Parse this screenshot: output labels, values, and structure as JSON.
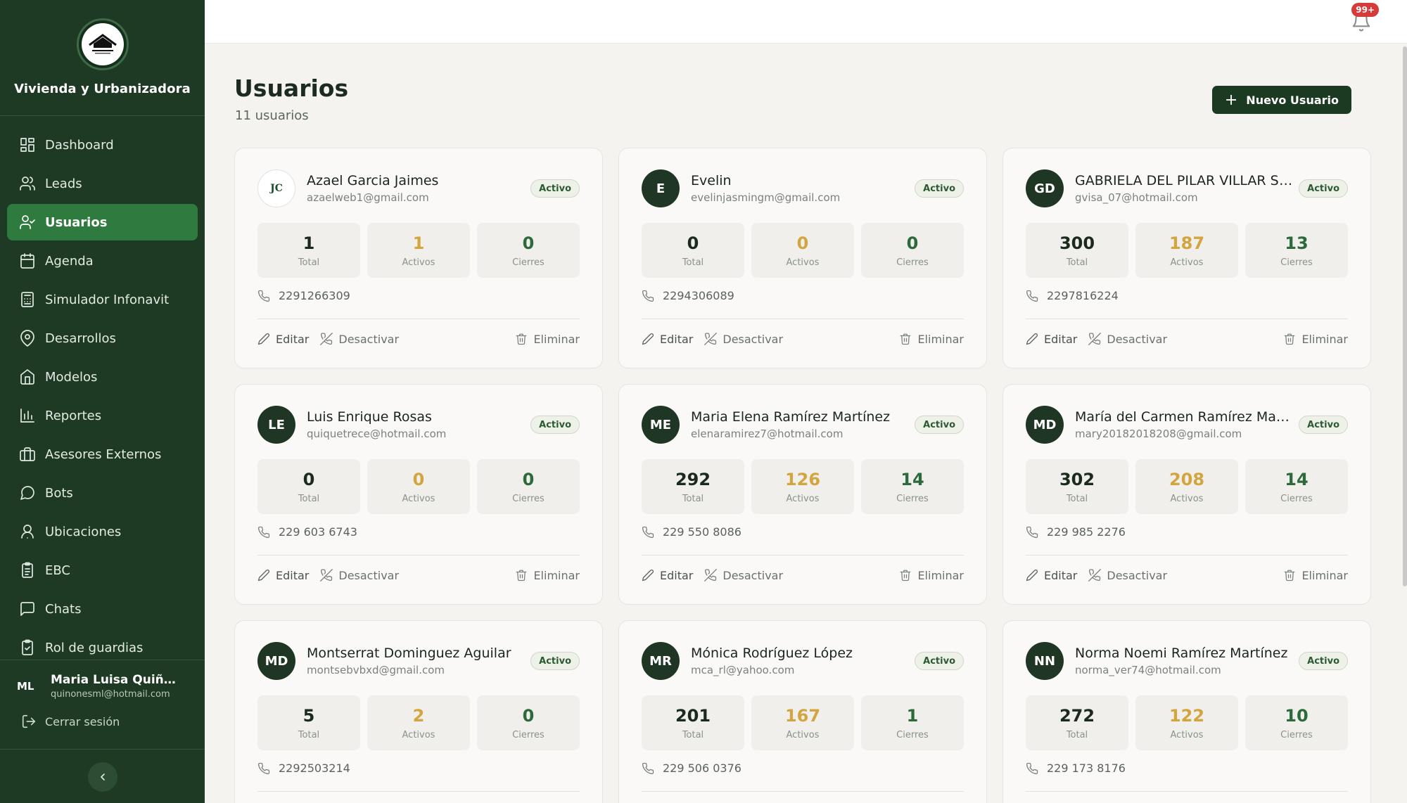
{
  "brand": {
    "name": "Vivienda y Urbanizadora",
    "logo_icon": "house-logo-icon"
  },
  "nav": {
    "items": [
      {
        "label": "Dashboard",
        "icon": "dashboard-icon"
      },
      {
        "label": "Leads",
        "icon": "users-icon"
      },
      {
        "label": "Usuarios",
        "icon": "user-check-icon",
        "active": true
      },
      {
        "label": "Agenda",
        "icon": "calendar-icon"
      },
      {
        "label": "Simulador Infonavit",
        "icon": "calculator-icon"
      },
      {
        "label": "Desarrollos",
        "icon": "map-pin-icon"
      },
      {
        "label": "Modelos",
        "icon": "home-icon"
      },
      {
        "label": "Reportes",
        "icon": "bar-chart-icon"
      },
      {
        "label": "Asesores Externos",
        "icon": "briefcase-icon"
      },
      {
        "label": "Bots",
        "icon": "message-circle-icon"
      },
      {
        "label": "Ubicaciones",
        "icon": "user-pin-icon"
      },
      {
        "label": "EBC",
        "icon": "clipboard-list-icon"
      },
      {
        "label": "Chats",
        "icon": "message-square-icon"
      },
      {
        "label": "Rol de guardias",
        "icon": "clipboard-check-icon"
      }
    ]
  },
  "current_user": {
    "initials": "ML",
    "name": "Maria Luisa Quiñone...",
    "email": "quinonesml@hotmail.com",
    "logout_label": "Cerrar sesión"
  },
  "notifications": {
    "count": "99+"
  },
  "header": {
    "title": "Usuarios",
    "count": "11 usuarios",
    "new_button": "Nuevo Usuario"
  },
  "labels": {
    "total": "Total",
    "activos": "Activos",
    "cierres": "Cierres",
    "edit": "Editar",
    "deactivate": "Desactivar",
    "delete": "Eliminar"
  },
  "users": [
    {
      "initials": "JC",
      "name": "Azael Garcia Jaimes",
      "email": "azaelweb1@gmail.com",
      "status": "Activo",
      "total": "1",
      "activos": "1",
      "cierres": "0",
      "phone": "2291266309",
      "logo_avatar": true
    },
    {
      "initials": "E",
      "name": "Evelin",
      "email": "evelinjasmingm@gmail.com",
      "status": "Activo",
      "total": "0",
      "activos": "0",
      "cierres": "0",
      "phone": "2294306089"
    },
    {
      "initials": "GD",
      "name": "GABRIELA DEL PILAR VILLAR SAN...",
      "email": "gvisa_07@hotmail.com",
      "status": "Activo",
      "total": "300",
      "activos": "187",
      "cierres": "13",
      "phone": "2297816224"
    },
    {
      "initials": "LE",
      "name": "Luis Enrique Rosas",
      "email": "quiquetrece@hotmail.com",
      "status": "Activo",
      "total": "0",
      "activos": "0",
      "cierres": "0",
      "phone": "229 603 6743"
    },
    {
      "initials": "ME",
      "name": "Maria Elena Ramírez Martínez",
      "email": "elenaramirez7@hotmail.com",
      "status": "Activo",
      "total": "292",
      "activos": "126",
      "cierres": "14",
      "phone": "229 550 8086"
    },
    {
      "initials": "MD",
      "name": "María del Carmen Ramírez Mar...",
      "email": "mary20182018208@gmail.com",
      "status": "Activo",
      "total": "302",
      "activos": "208",
      "cierres": "14",
      "phone": "229 985 2276"
    },
    {
      "initials": "MD",
      "name": "Montserrat Dominguez Aguilar",
      "email": "montsebvbxd@gmail.com",
      "status": "Activo",
      "total": "5",
      "activos": "2",
      "cierres": "0",
      "phone": "2292503214"
    },
    {
      "initials": "MR",
      "name": "Mónica Rodríguez López",
      "email": "mca_rl@yahoo.com",
      "status": "Activo",
      "total": "201",
      "activos": "167",
      "cierres": "1",
      "phone": "229 506 0376"
    },
    {
      "initials": "NN",
      "name": "Norma Noemi Ramírez Martínez",
      "email": "norma_ver74@hotmail.com",
      "status": "Activo",
      "total": "272",
      "activos": "122",
      "cierres": "10",
      "phone": "229 173 8176"
    }
  ],
  "colors": {
    "sidebar_bg": "#1e3a24",
    "active_nav": "#2f7a3e",
    "accent_gold": "#d3a53f",
    "accent_green": "#2c6a39",
    "badge_red": "#d63b3b"
  }
}
